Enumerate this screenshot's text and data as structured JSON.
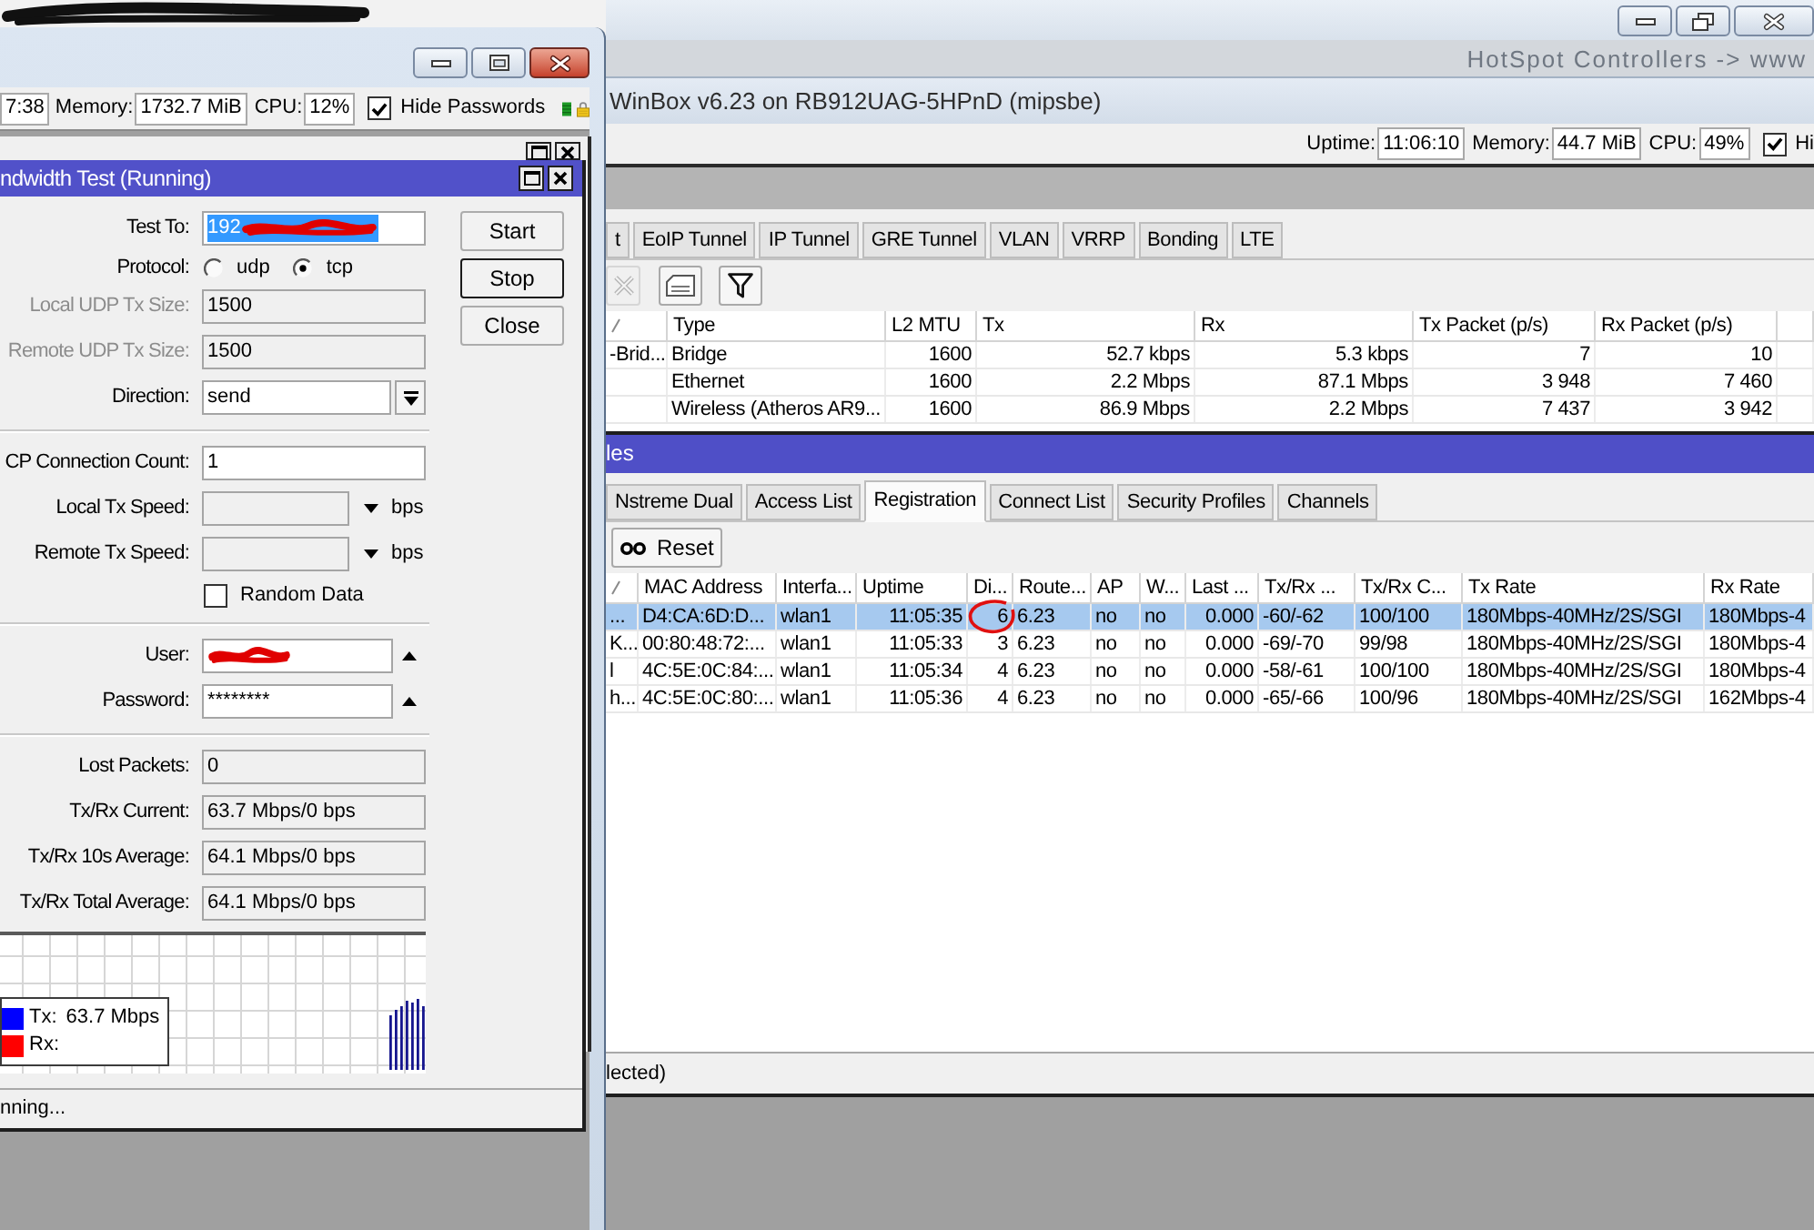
{
  "left_window": {
    "active": true,
    "status_bar": {
      "uptime": "7:38",
      "memory_label": "Memory:",
      "memory": "1732.7 MiB",
      "cpu_label": "CPU:",
      "cpu": "12%",
      "hide_passwords": {
        "label": "Hide Passwords",
        "checked": true
      }
    },
    "bandwidth_test": {
      "title": "ndwidth Test (Running)",
      "form": [
        {
          "kind": "input",
          "label": "Test To:",
          "value": "192",
          "disabled": false,
          "highlighted": true,
          "redacted": true
        },
        {
          "kind": "radio",
          "label": "Protocol:",
          "options": [
            {
              "label": "udp",
              "selected": false
            },
            {
              "label": "tcp",
              "selected": true
            }
          ]
        },
        {
          "kind": "input",
          "label": "Local UDP Tx Size:",
          "value": "1500",
          "disabled": true,
          "highlighted": false,
          "redacted": false
        },
        {
          "kind": "input",
          "label": "Remote UDP Tx Size:",
          "value": "1500",
          "disabled": true,
          "highlighted": false,
          "redacted": false
        },
        {
          "kind": "select",
          "label": "Direction:",
          "value": "send"
        },
        {
          "kind": "separator"
        },
        {
          "kind": "input",
          "label": "CP Connection Count:",
          "value": "1",
          "disabled": false,
          "highlighted": false,
          "redacted": false
        },
        {
          "kind": "speed",
          "label": "Local Tx Speed:",
          "unit": "bps"
        },
        {
          "kind": "speed",
          "label": "Remote Tx Speed:",
          "unit": "bps"
        },
        {
          "kind": "checkbox",
          "label": "Random Data",
          "checked": false
        },
        {
          "kind": "separator"
        },
        {
          "kind": "secret",
          "label": "User:",
          "redacted": true
        },
        {
          "kind": "secret",
          "label": "Password:",
          "value": "********",
          "redacted": false
        },
        {
          "kind": "separator"
        },
        {
          "kind": "readout",
          "label": "Lost Packets:",
          "value": "0"
        },
        {
          "kind": "readout",
          "label": "Tx/Rx Current:",
          "value": "63.7 Mbps/0 bps"
        },
        {
          "kind": "readout",
          "label": "Tx/Rx 10s Average:",
          "value": "64.1 Mbps/0 bps"
        },
        {
          "kind": "readout",
          "label": "Tx/Rx Total Average:",
          "value": "64.1 Mbps/0 bps"
        }
      ],
      "buttons": [
        {
          "label": "Start",
          "focused": false
        },
        {
          "label": "Stop",
          "focused": true
        },
        {
          "label": "Close",
          "focused": false
        }
      ],
      "legend": [
        {
          "label": "Tx:",
          "value": "63.7 Mbps",
          "color": "#0000ff"
        },
        {
          "label": "Rx:",
          "color": "#ff0000"
        }
      ],
      "status": "nning..."
    }
  },
  "main_window": {
    "active": false,
    "wallpaper_text": "HotSpot Controllers -> www",
    "title": "WinBox v6.23 on RB912UAG-5HPnD (mipsbe)",
    "status_bar": {
      "uptime_label": "Uptime:",
      "uptime": "11:06:10",
      "memory_label": "Memory:",
      "memory": "44.7 MiB",
      "cpu_label": "CPU:",
      "cpu": "49%",
      "hide_passwords": {
        "label": "Hi",
        "checked": true
      }
    },
    "interfaces": {
      "tabs": [
        {
          "label": "t",
          "selected": false
        },
        {
          "label": "EoIP Tunnel",
          "selected": false
        },
        {
          "label": "IP Tunnel",
          "selected": false
        },
        {
          "label": "GRE Tunnel",
          "selected": false
        },
        {
          "label": "VLAN",
          "selected": false
        },
        {
          "label": "VRRP",
          "selected": false
        },
        {
          "label": "Bonding",
          "selected": false
        },
        {
          "label": "LTE",
          "selected": false
        }
      ],
      "toolbar": [
        {
          "kind": "remove",
          "disabled": true
        },
        {
          "kind": "comment",
          "disabled": false
        },
        {
          "kind": "filter",
          "disabled": false
        }
      ],
      "table": {
        "columns": [
          {
            "sorted": true
          },
          {
            "label": "Type",
            "sorted": false
          },
          {
            "label": "L2 MTU",
            "sorted": false
          },
          {
            "label": "Tx",
            "sorted": false
          },
          {
            "label": "Rx",
            "sorted": false
          },
          {
            "label": "Tx Packet (p/s)",
            "sorted": false
          },
          {
            "label": "Rx Packet (p/s)",
            "sorted": false
          },
          {
            "sorted": false
          }
        ],
        "rows": [
          [
            "-Brid...",
            "Bridge",
            "1600",
            "52.7 kbps",
            "5.3 kbps",
            "7",
            "10"
          ],
          [
            null,
            "Ethernet",
            "1600",
            "2.2 Mbps",
            "87.1 Mbps",
            "3 948",
            "7 460"
          ],
          [
            null,
            "Wireless (Atheros AR9...",
            "1600",
            "86.9 Mbps",
            "2.2 Mbps",
            "7 437",
            "3 942"
          ]
        ]
      }
    },
    "wireless_tables": {
      "title": "les",
      "tabs": [
        {
          "label": "Nstreme Dual",
          "selected": false
        },
        {
          "label": "Access List",
          "selected": false
        },
        {
          "label": "Registration",
          "selected": true
        },
        {
          "label": "Connect List",
          "selected": false
        },
        {
          "label": "Security Profiles",
          "selected": false
        },
        {
          "label": "Channels",
          "selected": false
        }
      ],
      "reset_button": "Reset",
      "table": {
        "columns": [
          {
            "sorted": true
          },
          {
            "label": "MAC Address",
            "sorted": false
          },
          {
            "label": "Interfa...",
            "sorted": false
          },
          {
            "label": "Uptime",
            "sorted": false
          },
          {
            "label": "Di...",
            "sorted": false
          },
          {
            "label": "Route...",
            "sorted": false
          },
          {
            "label": "AP",
            "sorted": false
          },
          {
            "label": "W...",
            "sorted": false
          },
          {
            "label": "Last ...",
            "sorted": false
          },
          {
            "label": "Tx/Rx ...",
            "sorted": false
          },
          {
            "label": "Tx/Rx C...",
            "sorted": false
          },
          {
            "label": "Tx Rate",
            "sorted": false
          },
          {
            "label": "Rx Rate",
            "sorted": false
          }
        ],
        "rows": [
          {
            "selected": true,
            "cells": [
              "...",
              "D4:CA:6D:D...",
              "wlan1",
              "11:05:35",
              "6",
              "6.23",
              "no",
              "no",
              "0.000",
              "-60/-62",
              "100/100",
              "180Mbps-40MHz/2S/SGI",
              "180Mbps-4"
            ]
          },
          {
            "selected": false,
            "cells": [
              "K...",
              "00:80:48:72:...",
              "wlan1",
              "11:05:33",
              "3",
              "6.23",
              "no",
              "no",
              "0.000",
              "-69/-70",
              "99/98",
              "180Mbps-40MHz/2S/SGI",
              "180Mbps-4"
            ]
          },
          {
            "selected": false,
            "cells": [
              "l",
              "4C:5E:0C:84:...",
              "wlan1",
              "11:05:34",
              "4",
              "6.23",
              "no",
              "no",
              "0.000",
              "-58/-61",
              "100/100",
              "180Mbps-40MHz/2S/SGI",
              "180Mbps-4"
            ]
          },
          {
            "selected": false,
            "cells": [
              "h...",
              "4C:5E:0C:80:...",
              "wlan1",
              "11:05:36",
              "4",
              "6.23",
              "no",
              "no",
              "0.000",
              "-65/-66",
              "100/96",
              "180Mbps-40MHz/2S/SGI",
              "162Mbps-4"
            ]
          }
        ]
      },
      "status": "lected)"
    }
  }
}
